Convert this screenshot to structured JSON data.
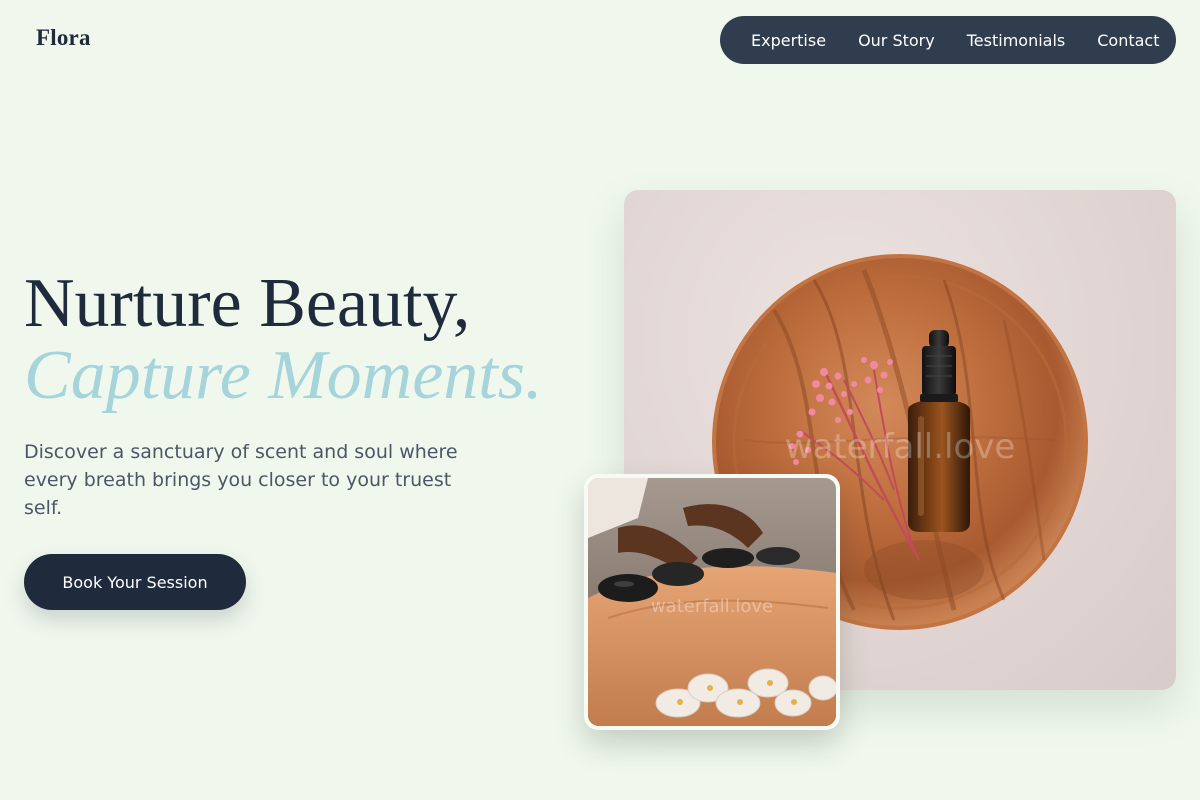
{
  "brand": {
    "name": "Flora"
  },
  "nav": {
    "items": [
      {
        "label": "Expertise"
      },
      {
        "label": "Our Story"
      },
      {
        "label": "Testimonials"
      },
      {
        "label": "Contact"
      }
    ]
  },
  "hero": {
    "headline": "Nurture Beauty,",
    "headline_accent": "Capture Moments.",
    "description": "Discover a sanctuary of scent and soul where every breath brings you closer to your truest self.",
    "cta_label": "Book Your Session"
  },
  "images": {
    "main": {
      "description": "Amber dropper bottle and pink flowers on a round wooden plate",
      "watermark": "waterfall.love"
    },
    "inset": {
      "description": "Hot stone massage with white orchids",
      "watermark": "waterfall.love"
    }
  },
  "colors": {
    "background": "#f0f8ee",
    "nav_background": "#2f3d4e",
    "primary": "#1f2a3c",
    "accent": "#a5d4da",
    "body_text": "#4b5666"
  }
}
